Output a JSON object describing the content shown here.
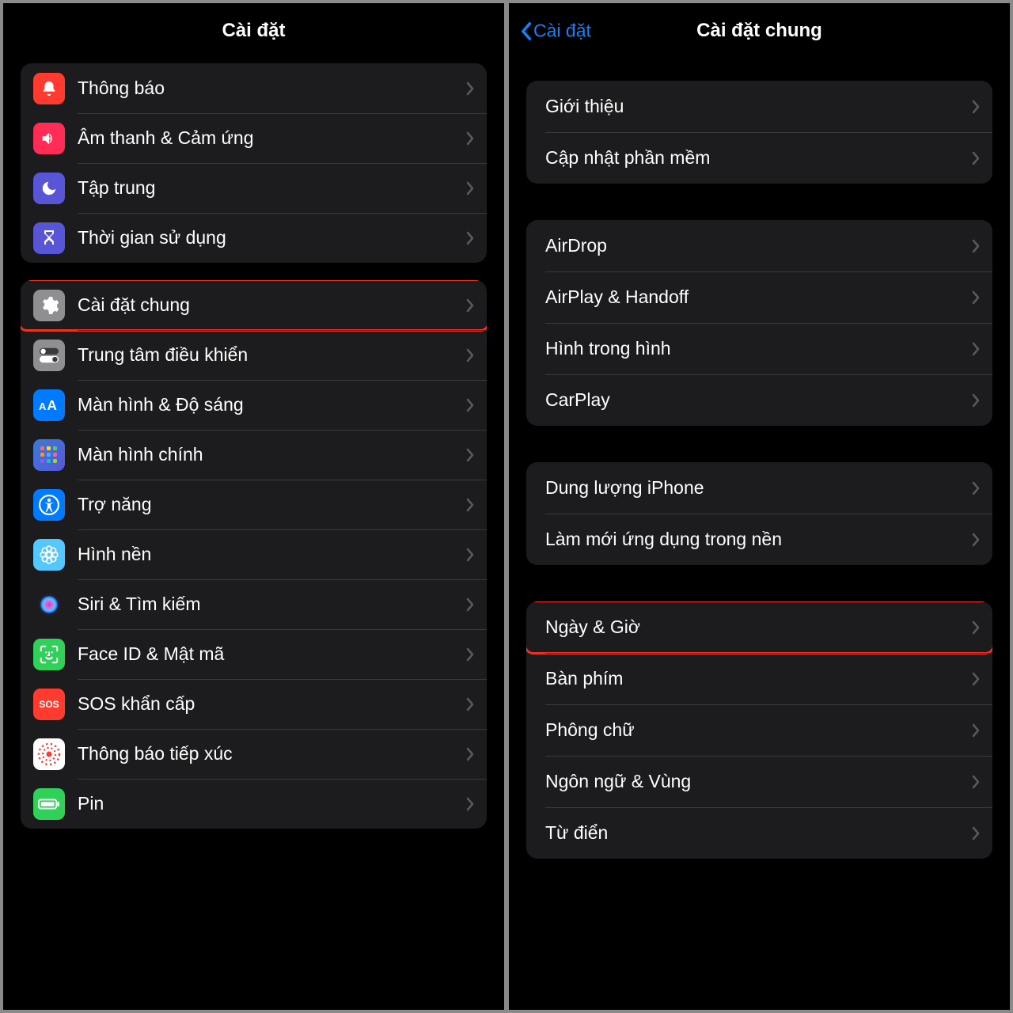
{
  "left": {
    "title": "Cài đặt",
    "groups": [
      {
        "rows": [
          {
            "id": "notifications",
            "label": "Thông báo",
            "icon": "bell-icon",
            "bg": "bg-red"
          },
          {
            "id": "sounds",
            "label": "Âm thanh & Cảm ứng",
            "icon": "speaker-icon",
            "bg": "bg-pink"
          },
          {
            "id": "focus",
            "label": "Tập trung",
            "icon": "moon-icon",
            "bg": "bg-indigo"
          },
          {
            "id": "screentime",
            "label": "Thời gian sử dụng",
            "icon": "hourglass-icon",
            "bg": "bg-indigo"
          }
        ]
      },
      {
        "rows": [
          {
            "id": "general",
            "label": "Cài đặt chung",
            "icon": "gear-icon",
            "bg": "bg-gray",
            "highlighted": true
          },
          {
            "id": "control-center",
            "label": "Trung tâm điều khiển",
            "icon": "toggles-icon",
            "bg": "bg-gray2"
          },
          {
            "id": "display",
            "label": "Màn hình & Độ sáng",
            "icon": "text-size-icon",
            "bg": "bg-blue"
          },
          {
            "id": "home-screen",
            "label": "Màn hình chính",
            "icon": "grid-icon",
            "bg": "bg-home"
          },
          {
            "id": "accessibility",
            "label": "Trợ năng",
            "icon": "accessibility-icon",
            "bg": "bg-blue"
          },
          {
            "id": "wallpaper",
            "label": "Hình nền",
            "icon": "flower-icon",
            "bg": "bg-lblue"
          },
          {
            "id": "siri",
            "label": "Siri & Tìm kiếm",
            "icon": "siri-icon",
            "bg": "bg-siri"
          },
          {
            "id": "faceid",
            "label": "Face ID & Mật mã",
            "icon": "faceid-icon",
            "bg": "bg-green"
          },
          {
            "id": "sos",
            "label": "SOS khẩn cấp",
            "icon": "sos-icon",
            "bg": "bg-sos"
          },
          {
            "id": "exposure",
            "label": "Thông báo tiếp xúc",
            "icon": "exposure-icon",
            "bg": "bg-dots"
          },
          {
            "id": "battery",
            "label": "Pin",
            "icon": "battery-icon",
            "bg": "bg-bat"
          }
        ]
      }
    ]
  },
  "right": {
    "back_label": "Cài đặt",
    "title": "Cài đặt chung",
    "groups": [
      {
        "rows": [
          {
            "id": "about",
            "label": "Giới thiệu"
          },
          {
            "id": "software-update",
            "label": "Cập nhật phần mềm"
          }
        ]
      },
      {
        "rows": [
          {
            "id": "airdrop",
            "label": "AirDrop"
          },
          {
            "id": "airplay",
            "label": "AirPlay & Handoff"
          },
          {
            "id": "pip",
            "label": "Hình trong hình"
          },
          {
            "id": "carplay",
            "label": "CarPlay"
          }
        ]
      },
      {
        "rows": [
          {
            "id": "storage",
            "label": "Dung lượng iPhone"
          },
          {
            "id": "background-refresh",
            "label": "Làm mới ứng dụng trong nền"
          }
        ]
      },
      {
        "rows": [
          {
            "id": "date-time",
            "label": "Ngày & Giờ",
            "highlighted": true
          },
          {
            "id": "keyboard",
            "label": "Bàn phím"
          },
          {
            "id": "fonts",
            "label": "Phông chữ"
          },
          {
            "id": "language-region",
            "label": "Ngôn ngữ & Vùng"
          },
          {
            "id": "dictionary",
            "label": "Từ điển"
          }
        ]
      }
    ]
  }
}
